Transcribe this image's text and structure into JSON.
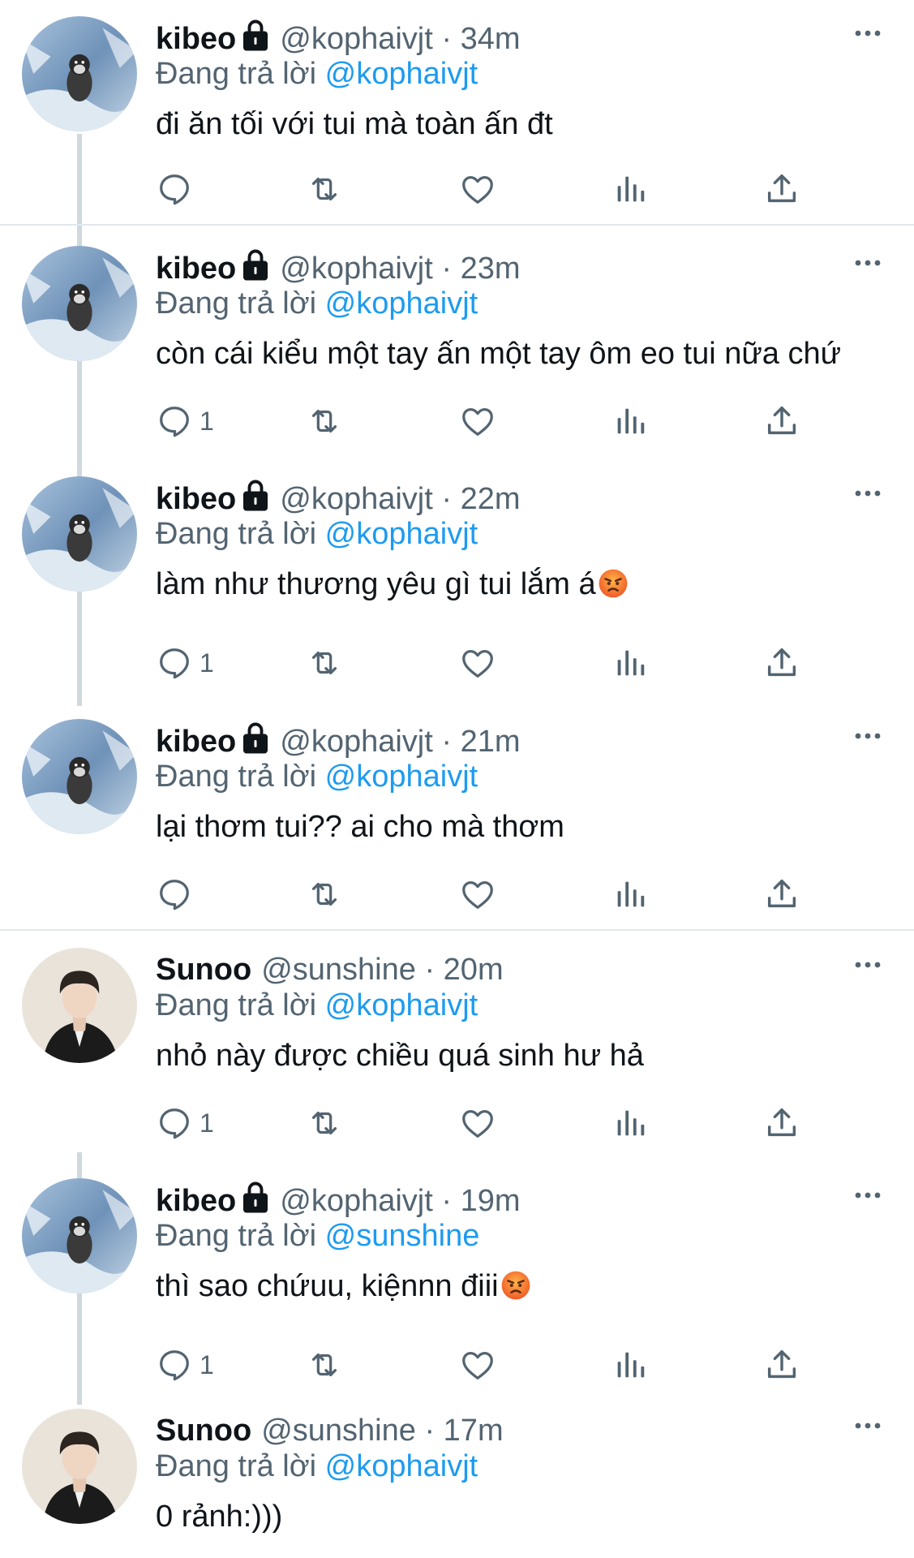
{
  "tweets": [
    {
      "name": "kibeo",
      "handle": "@kophaivjt",
      "sep": "·",
      "time": "34m",
      "reply_prefix": "Đang trả lời",
      "reply_to": "@kophaivjt",
      "text": "đi ăn tối với tui mà toàn ấn đt",
      "reply_count": "",
      "avatar": "penguin",
      "locked": true,
      "emoji": false
    },
    {
      "name": "kibeo",
      "handle": "@kophaivjt",
      "sep": "·",
      "time": "23m",
      "reply_prefix": "Đang trả lời",
      "reply_to": "@kophaivjt",
      "text": "còn cái kiểu một tay ấn một tay ôm eo tui nữa chứ",
      "reply_count": "1",
      "avatar": "penguin",
      "locked": true,
      "emoji": false
    },
    {
      "name": "kibeo",
      "handle": "@kophaivjt",
      "sep": "·",
      "time": "22m",
      "reply_prefix": "Đang trả lời",
      "reply_to": "@kophaivjt",
      "text": "làm như thương yêu gì tui lắm á",
      "reply_count": "1",
      "avatar": "penguin",
      "locked": true,
      "emoji": true
    },
    {
      "name": "kibeo",
      "handle": "@kophaivjt",
      "sep": "·",
      "time": "21m",
      "reply_prefix": "Đang trả lời",
      "reply_to": "@kophaivjt",
      "text": "lại thơm tui?? ai cho mà thơm",
      "reply_count": "",
      "avatar": "penguin",
      "locked": true,
      "emoji": false
    },
    {
      "name": "Sunoo",
      "handle": "@sunshine",
      "sep": "·",
      "time": "20m",
      "reply_prefix": "Đang trả lời",
      "reply_to": "@kophaivjt",
      "text": "nhỏ này được chiều quá sinh hư hả",
      "reply_count": "1",
      "avatar": "person",
      "locked": false,
      "emoji": false
    },
    {
      "name": "kibeo",
      "handle": "@kophaivjt",
      "sep": "·",
      "time": "19m",
      "reply_prefix": "Đang trả lời",
      "reply_to": "@sunshine",
      "text": "thì sao chứuu, kiệnnn điii",
      "reply_count": "1",
      "avatar": "penguin",
      "locked": true,
      "emoji": true
    },
    {
      "name": "Sunoo",
      "handle": "@sunshine",
      "sep": "·",
      "time": "17m",
      "reply_prefix": "Đang trả lời",
      "reply_to": "@kophaivjt",
      "text": "0 rảnh:)))",
      "reply_count": "",
      "avatar": "person",
      "locked": false,
      "emoji": false
    }
  ],
  "icons": {
    "reply": "reply-icon",
    "retweet": "retweet-icon",
    "like": "heart-icon",
    "views": "views-icon",
    "share": "share-icon",
    "more": "more-icon",
    "lock": "lock-icon",
    "angry": "angry-face-emoji"
  },
  "colors": {
    "text": "#0f1419",
    "secondary": "#536471",
    "link": "#1d9bf0",
    "divider": "#e1e8ed",
    "thread": "#cfd9de"
  }
}
